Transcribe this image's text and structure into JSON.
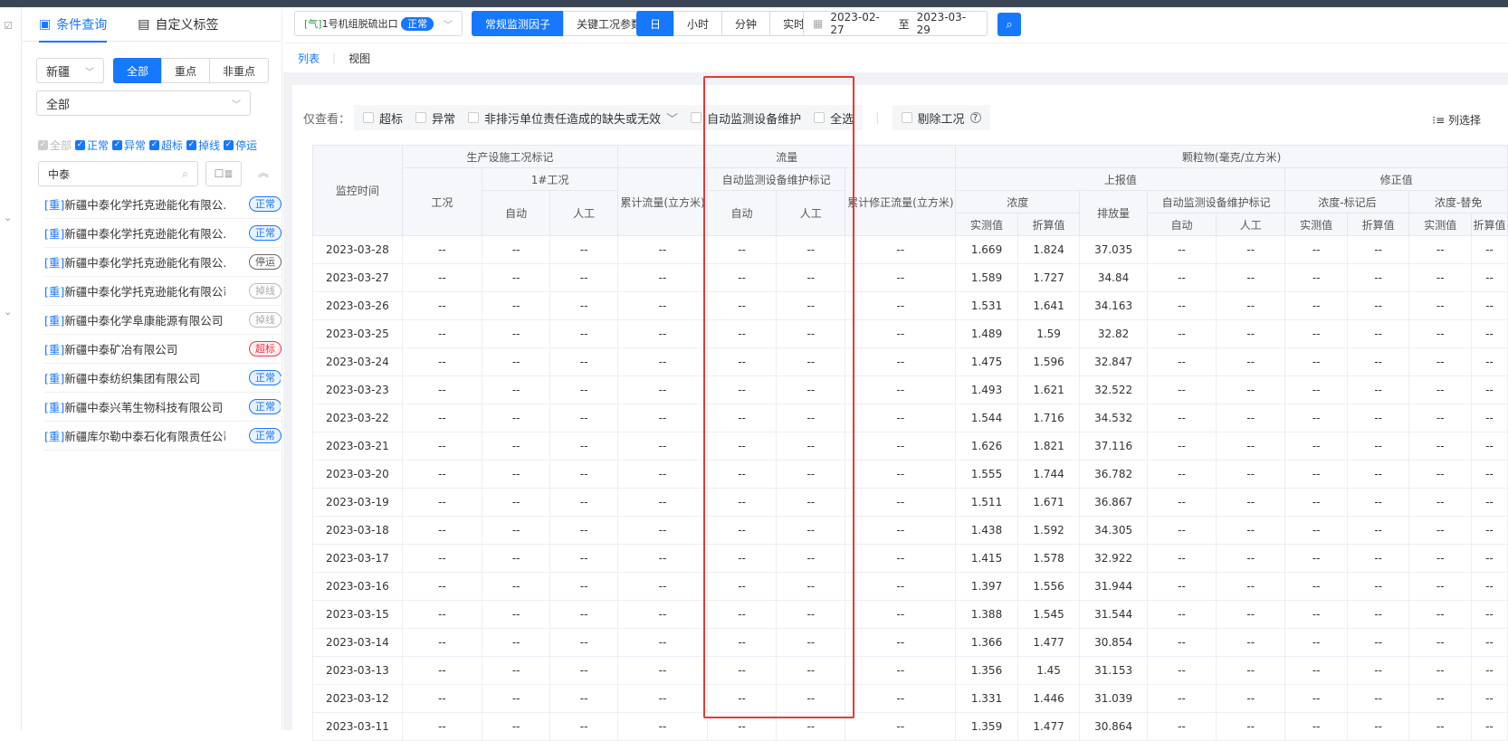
{
  "panel": {
    "tab_query": "条件查询",
    "tab_custom": "自定义标签",
    "region": "新疆",
    "key_seg": [
      "全部",
      "重点",
      "非重点"
    ],
    "type_select": "全部",
    "checks": [
      "全部",
      "正常",
      "异常",
      "超标",
      "掉线",
      "停运"
    ],
    "search_value": "中泰",
    "companies": [
      {
        "tag": "[重]",
        "name": "新疆中泰化学托克逊能化有限公...",
        "status": "正常",
        "kind": "ok"
      },
      {
        "tag": "[重]",
        "name": "新疆中泰化学托克逊能化有限公...",
        "status": "正常",
        "kind": "ok"
      },
      {
        "tag": "[重]",
        "name": "新疆中泰化学托克逊能化有限公...",
        "status": "停运",
        "kind": "stop"
      },
      {
        "tag": "[重]",
        "name": "新疆中泰化学托克逊能化有限公司",
        "status": "掉线",
        "kind": "off"
      },
      {
        "tag": "[重]",
        "name": "新疆中泰化学阜康能源有限公司",
        "status": "掉线",
        "kind": "off"
      },
      {
        "tag": "[重]",
        "name": "新疆中泰矿冶有限公司",
        "status": "超标",
        "kind": "over"
      },
      {
        "tag": "[重]",
        "name": "新疆中泰纺织集团有限公司",
        "status": "正常",
        "kind": "ok"
      },
      {
        "tag": "[重]",
        "name": "新疆中泰兴苇生物科技有限公司",
        "status": "正常",
        "kind": "ok"
      },
      {
        "tag": "[重]",
        "name": "新疆库尔勒中泰石化有限责任公司",
        "status": "正常",
        "kind": "ok"
      }
    ]
  },
  "toolbar": {
    "point_prefix": "[气]",
    "point_name": "1号机组脱硫出口",
    "point_status": "正常",
    "factor_seg": [
      "常规监测因子",
      "关键工况参数"
    ],
    "period_seg": [
      "日",
      "小时",
      "分钟",
      "实时"
    ],
    "date_from": "2023-02-27",
    "date_sep": "至",
    "date_to": "2023-03-29"
  },
  "subtabs": [
    "列表",
    "视图"
  ],
  "filter": {
    "label": "仅查看：",
    "options": [
      "超标",
      "异常",
      "非排污单位责任造成的缺失或无效",
      "自动监测设备维护",
      "全选"
    ],
    "exclude": "剔除工况",
    "column_select": "列选择"
  },
  "table": {
    "h_time": "监控时间",
    "h_prod": "生产设施工况标记",
    "h_cond": "工况",
    "h_cond1": "1#工况",
    "h_flow": "流量",
    "h_flow_cum": "累计流量(立方米)",
    "h_flow_maint": "自动监测设备维护标记",
    "h_flow_fix": "累计修正流量(立方米)",
    "h_pm": "颗粒物(毫克/立方米)",
    "h_report": "上报值",
    "h_conc": "浓度",
    "h_emis": "排放量",
    "h_pm_maint": "自动监测设备维护标记",
    "h_tagged": "浓度-标记后",
    "h_fixed": "修正值",
    "h_fixed_conc": "浓度-替免",
    "h_auto": "自动",
    "h_manual": "人工",
    "h_meas": "实测值",
    "h_conv": "折算值",
    "dash": "--",
    "rows": [
      [
        "2023-03-28",
        "1.669",
        "1.824",
        "37.035"
      ],
      [
        "2023-03-27",
        "1.589",
        "1.727",
        "34.84"
      ],
      [
        "2023-03-26",
        "1.531",
        "1.641",
        "34.163"
      ],
      [
        "2023-03-25",
        "1.489",
        "1.59",
        "32.82"
      ],
      [
        "2023-03-24",
        "1.475",
        "1.596",
        "32.847"
      ],
      [
        "2023-03-23",
        "1.493",
        "1.621",
        "32.522"
      ],
      [
        "2023-03-22",
        "1.544",
        "1.716",
        "34.532"
      ],
      [
        "2023-03-21",
        "1.626",
        "1.821",
        "37.116"
      ],
      [
        "2023-03-20",
        "1.555",
        "1.744",
        "36.782"
      ],
      [
        "2023-03-19",
        "1.511",
        "1.671",
        "36.867"
      ],
      [
        "2023-03-18",
        "1.438",
        "1.592",
        "34.305"
      ],
      [
        "2023-03-17",
        "1.415",
        "1.578",
        "32.922"
      ],
      [
        "2023-03-16",
        "1.397",
        "1.556",
        "31.944"
      ],
      [
        "2023-03-15",
        "1.388",
        "1.545",
        "31.544"
      ],
      [
        "2023-03-14",
        "1.366",
        "1.477",
        "30.854"
      ],
      [
        "2023-03-13",
        "1.356",
        "1.45",
        "31.153"
      ],
      [
        "2023-03-12",
        "1.331",
        "1.446",
        "31.039"
      ],
      [
        "2023-03-11",
        "1.359",
        "1.477",
        "30.864"
      ]
    ]
  }
}
